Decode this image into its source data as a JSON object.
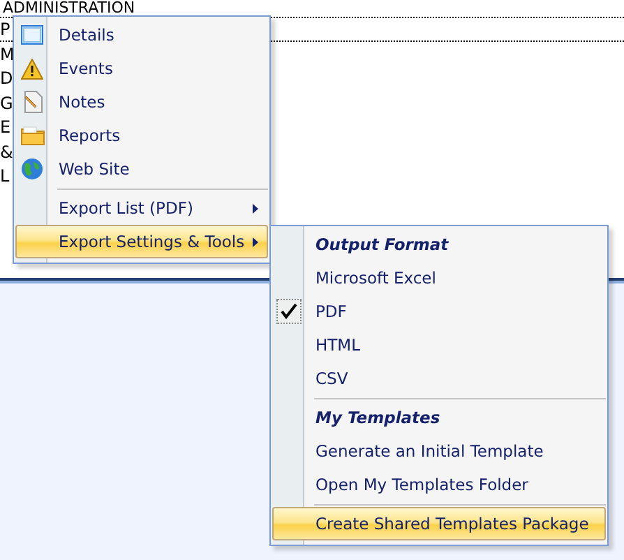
{
  "background_list": {
    "header": "ADMINISTRATION",
    "rows": [
      {
        "label": "P",
        "selected": true
      },
      {
        "label": "M",
        "selected": false
      },
      {
        "label": "D",
        "selected": false
      },
      {
        "label": "G",
        "selected": false
      },
      {
        "label": "E",
        "selected": false
      },
      {
        "label": "&",
        "selected": false
      },
      {
        "label": "L",
        "selected": false
      }
    ]
  },
  "context_menu": {
    "items": [
      {
        "kind": "item",
        "label": "Details",
        "selected": false
      },
      {
        "kind": "item",
        "label": "Events",
        "selected": false
      },
      {
        "kind": "item",
        "label": "Notes",
        "selected": false
      },
      {
        "kind": "item",
        "label": "Reports",
        "selected": false
      },
      {
        "kind": "item",
        "label": "Web Site",
        "selected": false
      },
      {
        "kind": "separator"
      },
      {
        "kind": "submenu",
        "label": "Export List (PDF)",
        "selected": false
      },
      {
        "kind": "submenu",
        "label": "Export Settings & Tools",
        "selected": true
      }
    ]
  },
  "submenu": {
    "items": [
      {
        "kind": "heading",
        "label": "Output Format"
      },
      {
        "kind": "item",
        "label": "Microsoft Excel",
        "checked": false,
        "selected": false
      },
      {
        "kind": "item",
        "label": "PDF",
        "checked": true,
        "selected": false
      },
      {
        "kind": "item",
        "label": "HTML",
        "checked": false,
        "selected": false
      },
      {
        "kind": "item",
        "label": "CSV",
        "checked": false,
        "selected": false
      },
      {
        "kind": "separator"
      },
      {
        "kind": "heading",
        "label": "My Templates"
      },
      {
        "kind": "item",
        "label": "Generate an Initial Template",
        "checked": false,
        "selected": false
      },
      {
        "kind": "item",
        "label": "Open My Templates Folder",
        "checked": false,
        "selected": false
      },
      {
        "kind": "separator"
      },
      {
        "kind": "item",
        "label": "Create Shared Templates Package",
        "checked": false,
        "selected": true
      }
    ]
  }
}
